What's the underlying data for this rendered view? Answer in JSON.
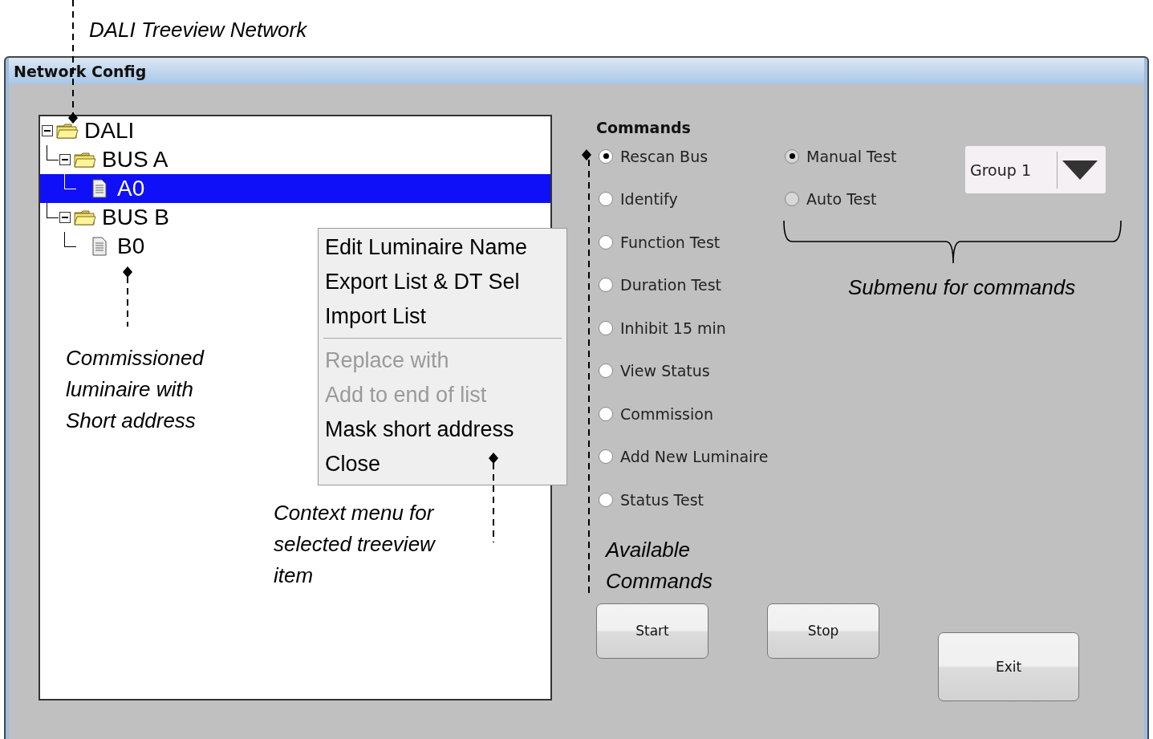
{
  "annotations": {
    "treeview": "DALI Treeview Network",
    "luminaire": "Commissioned luminaire with Short address",
    "context_menu": "Context menu for selected treeview item",
    "submenu": "Submenu for commands",
    "commands": "Available Commands"
  },
  "window": {
    "title": "Network Config"
  },
  "tree": {
    "nodes": [
      {
        "label": "DALI",
        "kind": "folder",
        "expanded": true,
        "selected": false,
        "children": [
          {
            "label": "BUS A",
            "kind": "folder",
            "expanded": true,
            "selected": false,
            "children": [
              {
                "label": "A0",
                "kind": "luminaire",
                "selected": true
              }
            ]
          },
          {
            "label": "BUS B",
            "kind": "folder",
            "expanded": true,
            "selected": false,
            "children": [
              {
                "label": "B0",
                "kind": "luminaire",
                "selected": false
              }
            ]
          }
        ]
      }
    ]
  },
  "context_menu": {
    "groups": [
      [
        {
          "label": "Edit Luminaire Name",
          "disabled": false
        },
        {
          "label": "Export List & DT Sel",
          "disabled": false
        },
        {
          "label": "Import List",
          "disabled": false
        }
      ],
      [
        {
          "label": "Replace with",
          "disabled": true
        },
        {
          "label": "Add to end of list",
          "disabled": true
        },
        {
          "label": "Mask short address",
          "disabled": false
        },
        {
          "label": "Close",
          "disabled": false
        }
      ]
    ]
  },
  "commands": {
    "title": "Commands",
    "options": [
      {
        "label": "Rescan Bus",
        "selected": true
      },
      {
        "label": "Identify",
        "selected": false
      },
      {
        "label": "Function Test",
        "selected": false
      },
      {
        "label": "Duration Test",
        "selected": false
      },
      {
        "label": "Inhibit 15 min",
        "selected": false
      },
      {
        "label": "View Status",
        "selected": false
      },
      {
        "label": "Commission",
        "selected": false
      },
      {
        "label": "Add New Luminaire",
        "selected": false
      },
      {
        "label": "Status Test",
        "selected": false
      }
    ]
  },
  "submenu": {
    "options": [
      {
        "label": "Manual Test",
        "selected": true
      },
      {
        "label": "Auto Test",
        "selected": false
      }
    ],
    "group_select": {
      "value": "Group 1"
    }
  },
  "buttons": [
    {
      "label": "Start"
    },
    {
      "label": "Stop"
    },
    {
      "label": "Exit"
    }
  ]
}
